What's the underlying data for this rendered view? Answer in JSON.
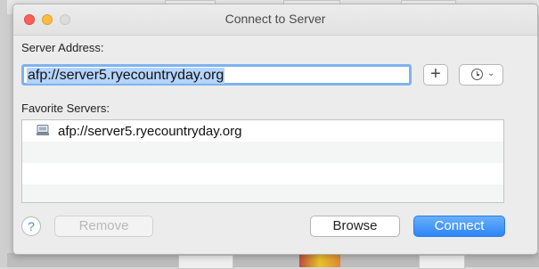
{
  "window": {
    "title": "Connect to Server"
  },
  "server_address": {
    "label": "Server Address:",
    "value": "afp://server5.ryecountryday.org",
    "add_button_label": "+",
    "recent_icon": "clock-icon",
    "recent_chevron": "⌄"
  },
  "favorites": {
    "label": "Favorite Servers:",
    "items": [
      {
        "icon": "server-icon",
        "label": "afp://server5.ryecountryday.org"
      }
    ]
  },
  "buttons": {
    "help": "?",
    "remove": "Remove",
    "browse": "Browse",
    "connect": "Connect"
  },
  "colors": {
    "accent": "#2b86f7",
    "selection": "#b4d4fb",
    "close": "#fc605b",
    "minimize": "#fdbc40"
  }
}
